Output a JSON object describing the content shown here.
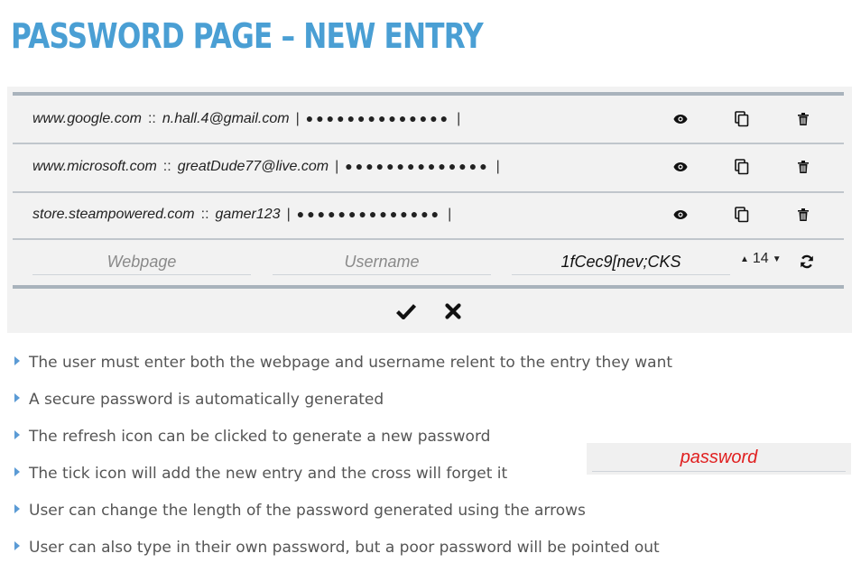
{
  "title": "PASSWORD PAGE – NEW ENTRY",
  "entries": [
    {
      "site": "www.google.com",
      "sep": "::",
      "user": "n.hall.4@gmail.com",
      "pipe": "|",
      "dots": "●●●●●●●●●●●●●●",
      "pipe_end": "|"
    },
    {
      "site": "www.microsoft.com",
      "sep": "::",
      "user": "greatDude77@live.com",
      "pipe": "|",
      "dots": "●●●●●●●●●●●●●●",
      "pipe_end": "|"
    },
    {
      "site": "store.steampowered.com",
      "sep": "::",
      "user": "gamer123",
      "pipe": "|",
      "dots": "●●●●●●●●●●●●●●",
      "pipe_end": "|"
    }
  ],
  "row_icons": [
    "eye-icon",
    "copy-icon",
    "trash-icon"
  ],
  "new_entry": {
    "webpage_placeholder": "Webpage",
    "username_placeholder": "Username",
    "password_value": "1fCec9[nev;CKS",
    "length": "14",
    "refresh_icon": "refresh-icon"
  },
  "actions": {
    "confirm_icon": "check-icon",
    "cancel_icon": "cross-icon"
  },
  "bullets": [
    "The user must enter both the webpage and username relent to the entry they want",
    "A secure password is automatically generated",
    "The refresh icon can be clicked to generate a new password",
    "The tick icon will add the new entry and the cross will forget it",
    "User can change the length of the password generated using the arrows",
    "User can also type in their own password, but a poor password will be pointed out"
  ],
  "sample_weak_password": "password",
  "colors": {
    "title": "#4a9fd4",
    "bullet_marker": "#5b9bd5",
    "weak_password": "#e02020",
    "panel": "#f2f2f2"
  }
}
